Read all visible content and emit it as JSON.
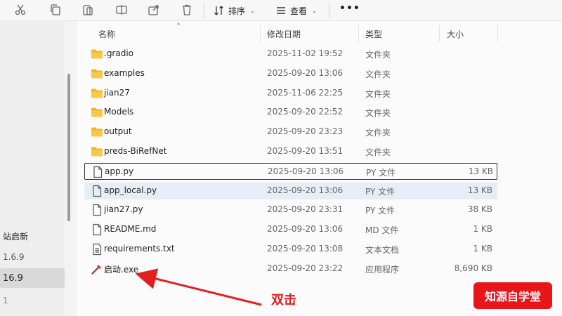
{
  "toolbar": {
    "sort_label": "排序",
    "view_label": "查看",
    "more_label": "•••"
  },
  "nav": {
    "items": [
      {
        "label": "站启新"
      },
      {
        "label": "1.6.9"
      },
      {
        "label": "16.9"
      },
      {
        "label": "1"
      }
    ]
  },
  "columns": {
    "name": "名称",
    "date": "修改日期",
    "type": "类型",
    "size": "大小"
  },
  "files": [
    {
      "name": ".gradio",
      "date": "2025-11-02 19:52",
      "type": "文件夹",
      "size": "",
      "icon": "folder-icon"
    },
    {
      "name": "examples",
      "date": "2025-09-20 13:06",
      "type": "文件夹",
      "size": "",
      "icon": "folder-icon"
    },
    {
      "name": "jian27",
      "date": "2025-11-06 22:25",
      "type": "文件夹",
      "size": "",
      "icon": "folder-icon"
    },
    {
      "name": "Models",
      "date": "2025-09-20 22:52",
      "type": "文件夹",
      "size": "",
      "icon": "folder-icon"
    },
    {
      "name": "output",
      "date": "2025-09-20 23:23",
      "type": "文件夹",
      "size": "",
      "icon": "folder-icon"
    },
    {
      "name": "preds-BiRefNet",
      "date": "2025-09-20 13:51",
      "type": "文件夹",
      "size": "",
      "icon": "folder-icon"
    },
    {
      "name": "app.py",
      "date": "2025-09-20 13:06",
      "type": "PY 文件",
      "size": "13 KB",
      "icon": "file-icon"
    },
    {
      "name": "app_local.py",
      "date": "2025-09-20 13:06",
      "type": "PY 文件",
      "size": "13 KB",
      "icon": "file-icon"
    },
    {
      "name": "jian27.py",
      "date": "2025-09-20 23:31",
      "type": "PY 文件",
      "size": "38 KB",
      "icon": "file-icon"
    },
    {
      "name": "README.md",
      "date": "2025-09-20 13:06",
      "type": "MD 文件",
      "size": "1 KB",
      "icon": "file-icon"
    },
    {
      "name": "requirements.txt",
      "date": "2025-09-20 13:08",
      "type": "文本文档",
      "size": "1 KB",
      "icon": "text-file-icon"
    },
    {
      "name": "启动.exe",
      "date": "2025-09-20 23:22",
      "type": "应用程序",
      "size": "8,690 KB",
      "icon": "exe-icon"
    }
  ],
  "annotation": {
    "callout": "双击",
    "brand": "知源自学堂"
  },
  "colors": {
    "folder": "#f0b429",
    "accent_red": "#e02020",
    "hover_row": "#e5eef7"
  }
}
